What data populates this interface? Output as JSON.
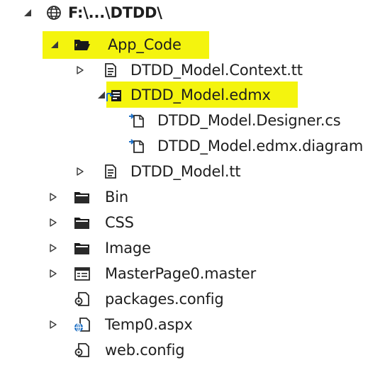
{
  "colors": {
    "highlight": "#f4f40e",
    "folder": "#1a1a1a",
    "arrow": "#3a3a3a",
    "accent": "#1d6fc5"
  },
  "tree": {
    "root": {
      "label": "F:\\...\\DTDD\\",
      "icon": "globe-icon",
      "expanded": true
    },
    "app_code": {
      "label": "App_Code",
      "icon": "folder-open-icon",
      "expanded": true,
      "highlighted": true
    },
    "model_context_tt": {
      "label": "DTDD_Model.Context.tt",
      "icon": "text-template-icon",
      "expanded": false
    },
    "model_edmx": {
      "label": "DTDD_Model.edmx",
      "icon": "edmx-icon",
      "expanded": true,
      "highlighted": true
    },
    "model_designer_cs": {
      "label": "DTDD_Model.Designer.cs",
      "icon": "generated-file-icon"
    },
    "model_edmx_diagram": {
      "label": "DTDD_Model.edmx.diagram",
      "icon": "generated-file-icon"
    },
    "model_tt": {
      "label": "DTDD_Model.tt",
      "icon": "text-template-icon",
      "expanded": false
    },
    "bin": {
      "label": "Bin",
      "icon": "folder-icon",
      "expanded": false
    },
    "css": {
      "label": "CSS",
      "icon": "folder-icon",
      "expanded": false
    },
    "image": {
      "label": "Image",
      "icon": "folder-icon",
      "expanded": false
    },
    "master_page": {
      "label": "MasterPage0.master",
      "icon": "master-page-icon",
      "expanded": false
    },
    "packages_config": {
      "label": "packages.config",
      "icon": "config-file-icon"
    },
    "temp_aspx": {
      "label": "Temp0.aspx",
      "icon": "aspx-page-icon",
      "expanded": false
    },
    "web_config": {
      "label": "web.config",
      "icon": "config-file-icon"
    }
  }
}
